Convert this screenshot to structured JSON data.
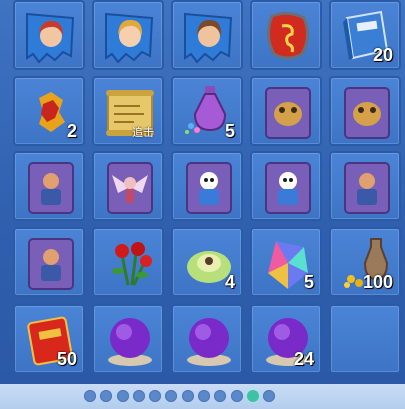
{
  "inventory": {
    "rows": [
      [
        {
          "icon": "portrait-card-red-hair-icon"
        },
        {
          "icon": "portrait-card-blonde-icon"
        },
        {
          "icon": "portrait-card-brown-hair-icon"
        },
        {
          "icon": "red-gem-talisman-icon"
        },
        {
          "icon": "blue-book-icon",
          "quantity": "20"
        }
      ],
      [
        {
          "icon": "red-gold-charm-icon",
          "quantity": "2"
        },
        {
          "icon": "golden-scroll-map-icon",
          "tag": "追击"
        },
        {
          "icon": "purple-potion-flask-icon",
          "quantity": "5"
        },
        {
          "icon": "purple-beast-card-icon"
        },
        {
          "icon": "purple-beast-card-icon"
        }
      ],
      [
        {
          "icon": "purple-warrior-card-icon"
        },
        {
          "icon": "purple-winged-fairy-card-icon"
        },
        {
          "icon": "purple-robot-card-icon"
        },
        {
          "icon": "purple-robot-card-icon"
        },
        {
          "icon": "purple-warrior-card-icon"
        }
      ],
      [
        {
          "icon": "purple-warrior-card-icon"
        },
        {
          "icon": "red-roses-icon"
        },
        {
          "icon": "green-cabbage-icon",
          "quantity": "4"
        },
        {
          "icon": "rainbow-crystal-icon",
          "quantity": "5"
        },
        {
          "icon": "coin-vase-icon",
          "quantity": "100"
        }
      ],
      [
        {
          "icon": "red-envelope-icon",
          "quantity": "50"
        },
        {
          "icon": "purple-orb-icon"
        },
        {
          "icon": "purple-orb-icon"
        },
        {
          "icon": "purple-orb-icon",
          "quantity": "24"
        },
        {
          "icon": ""
        }
      ]
    ]
  },
  "pager": {
    "pages": 12,
    "current_page": 11
  },
  "colors": {
    "card_blue": "#2f7bd8",
    "card_purple": "#7a5fb8",
    "dot_inactive": "#5b88c8",
    "dot_active": "#3ec2a6"
  }
}
